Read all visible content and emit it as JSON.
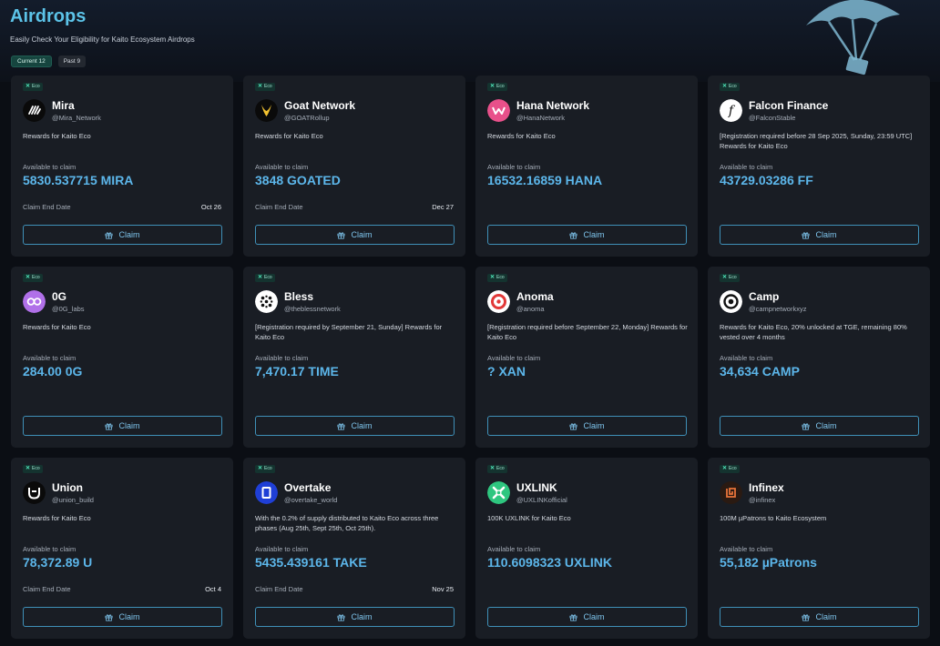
{
  "header": {
    "title": "Airdrops",
    "subtitle": "Easily Check Your Eligibility for Kaito Ecosystem Airdrops"
  },
  "tabs": [
    {
      "label": "Current 12",
      "active": true
    },
    {
      "label": "Past 9",
      "active": false
    }
  ],
  "labels": {
    "eco": "Eco",
    "available": "Available to claim",
    "claim_end": "Claim End Date",
    "claim_button": "Claim"
  },
  "colors": {
    "accent": "#5cb6ea",
    "title": "#5cc3e8",
    "card_bg": "#191d24",
    "page_bg": "#0b0e14",
    "eco_badge": "#14332f"
  },
  "cards": [
    {
      "name": "Mira",
      "handle": "@Mira_Network",
      "desc": "Rewards for Kaito Eco",
      "amount": "5830.537715 MIRA",
      "end_date": "Oct 26",
      "icon": "mira-logo-icon"
    },
    {
      "name": "Goat Network",
      "handle": "@GOATRollup",
      "desc": "Rewards for Kaito Eco",
      "amount": "3848 GOATED",
      "end_date": "Dec 27",
      "icon": "goat-logo-icon"
    },
    {
      "name": "Hana Network",
      "handle": "@HanaNetwork",
      "desc": "Rewards for Kaito Eco",
      "amount": "16532.16859 HANA",
      "end_date": "",
      "icon": "hana-logo-icon"
    },
    {
      "name": "Falcon Finance",
      "handle": "@FalconStable",
      "desc": "[Registration required before 28 Sep 2025, Sunday, 23:59 UTC] Rewards for Kaito Eco",
      "amount": "43729.03286 FF",
      "end_date": "",
      "icon": "falcon-logo-icon"
    },
    {
      "name": "0G",
      "handle": "@0G_labs",
      "desc": "Rewards for Kaito Eco",
      "amount": "284.00 0G",
      "end_date": "",
      "icon": "0g-logo-icon"
    },
    {
      "name": "Bless",
      "handle": "@theblessnetwork",
      "desc": "[Registration required by September 21, Sunday] Rewards for Kaito Eco",
      "amount": "7,470.17 TIME",
      "end_date": "",
      "icon": "bless-logo-icon"
    },
    {
      "name": "Anoma",
      "handle": "@anoma",
      "desc": "[Registration required before September 22, Monday] Rewards for Kaito Eco",
      "amount": "? XAN",
      "end_date": "",
      "icon": "anoma-logo-icon"
    },
    {
      "name": "Camp",
      "handle": "@campnetworkxyz",
      "desc": "Rewards for Kaito Eco, 20% unlocked at TGE, remaining 80% vested over 4 months",
      "amount": "34,634 CAMP",
      "end_date": "",
      "icon": "camp-logo-icon"
    },
    {
      "name": "Union",
      "handle": "@union_build",
      "desc": "Rewards for Kaito Eco",
      "amount": "78,372.89 U",
      "end_date": "Oct 4",
      "icon": "union-logo-icon"
    },
    {
      "name": "Overtake",
      "handle": "@overtake_world",
      "desc": "With the 0.2% of supply distributed to Kaito Eco across three phases (Aug 25th, Sept 25th, Oct 25th).",
      "amount": "5435.439161 TAKE",
      "end_date": "Nov 25",
      "icon": "overtake-logo-icon"
    },
    {
      "name": "UXLINK",
      "handle": "@UXLINKofficial",
      "desc": "100K UXLINK for Kaito Eco",
      "amount": "110.6098323 UXLINK",
      "end_date": "",
      "icon": "uxlink-logo-icon"
    },
    {
      "name": "Infinex",
      "handle": "@infinex",
      "desc": "100M µPatrons to Kaito Ecosystem",
      "amount": "55,182 µPatrons",
      "end_date": "",
      "icon": "infinex-logo-icon"
    }
  ]
}
